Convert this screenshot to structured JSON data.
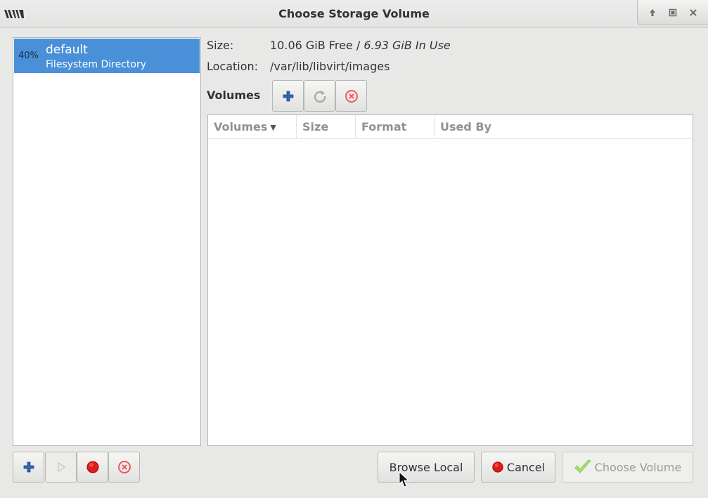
{
  "window": {
    "title": "Choose Storage Volume",
    "app_icon": "virt-manager-logo-icon",
    "controls": [
      "restore-icon",
      "maximize-icon",
      "close-icon"
    ]
  },
  "pools": [
    {
      "usage": "40%",
      "name": "default",
      "type": "Filesystem Directory",
      "selected": true
    }
  ],
  "details": {
    "size_label": "Size:",
    "size_free": "10.06 GiB Free",
    "size_separator": " / ",
    "size_in_use": "6.93 GiB In Use",
    "location_label": "Location:",
    "location_value": "/var/lib/libvirt/images",
    "volumes_heading": "Volumes"
  },
  "volume_toolbar": {
    "add_icon": "plus-icon",
    "refresh_icon": "refresh-icon",
    "delete_icon": "delete-icon"
  },
  "volume_table": {
    "columns": [
      "Volumes",
      "Size",
      "Format",
      "Used By"
    ],
    "sorted_column": "Volumes",
    "rows": []
  },
  "pool_toolbar": {
    "add_icon": "plus-icon",
    "start_icon": "play-icon",
    "stop_icon": "stop-icon",
    "delete_icon": "delete-icon"
  },
  "dialog_buttons": {
    "browse_local": "Browse Local",
    "cancel": "Cancel",
    "choose_volume": "Choose Volume"
  },
  "colors": {
    "selection": "#4a90d9",
    "stop_red": "#e01b1b",
    "delete_red": "#e06060",
    "add_blue": "#3465a4",
    "check_green": "#8ae234"
  }
}
